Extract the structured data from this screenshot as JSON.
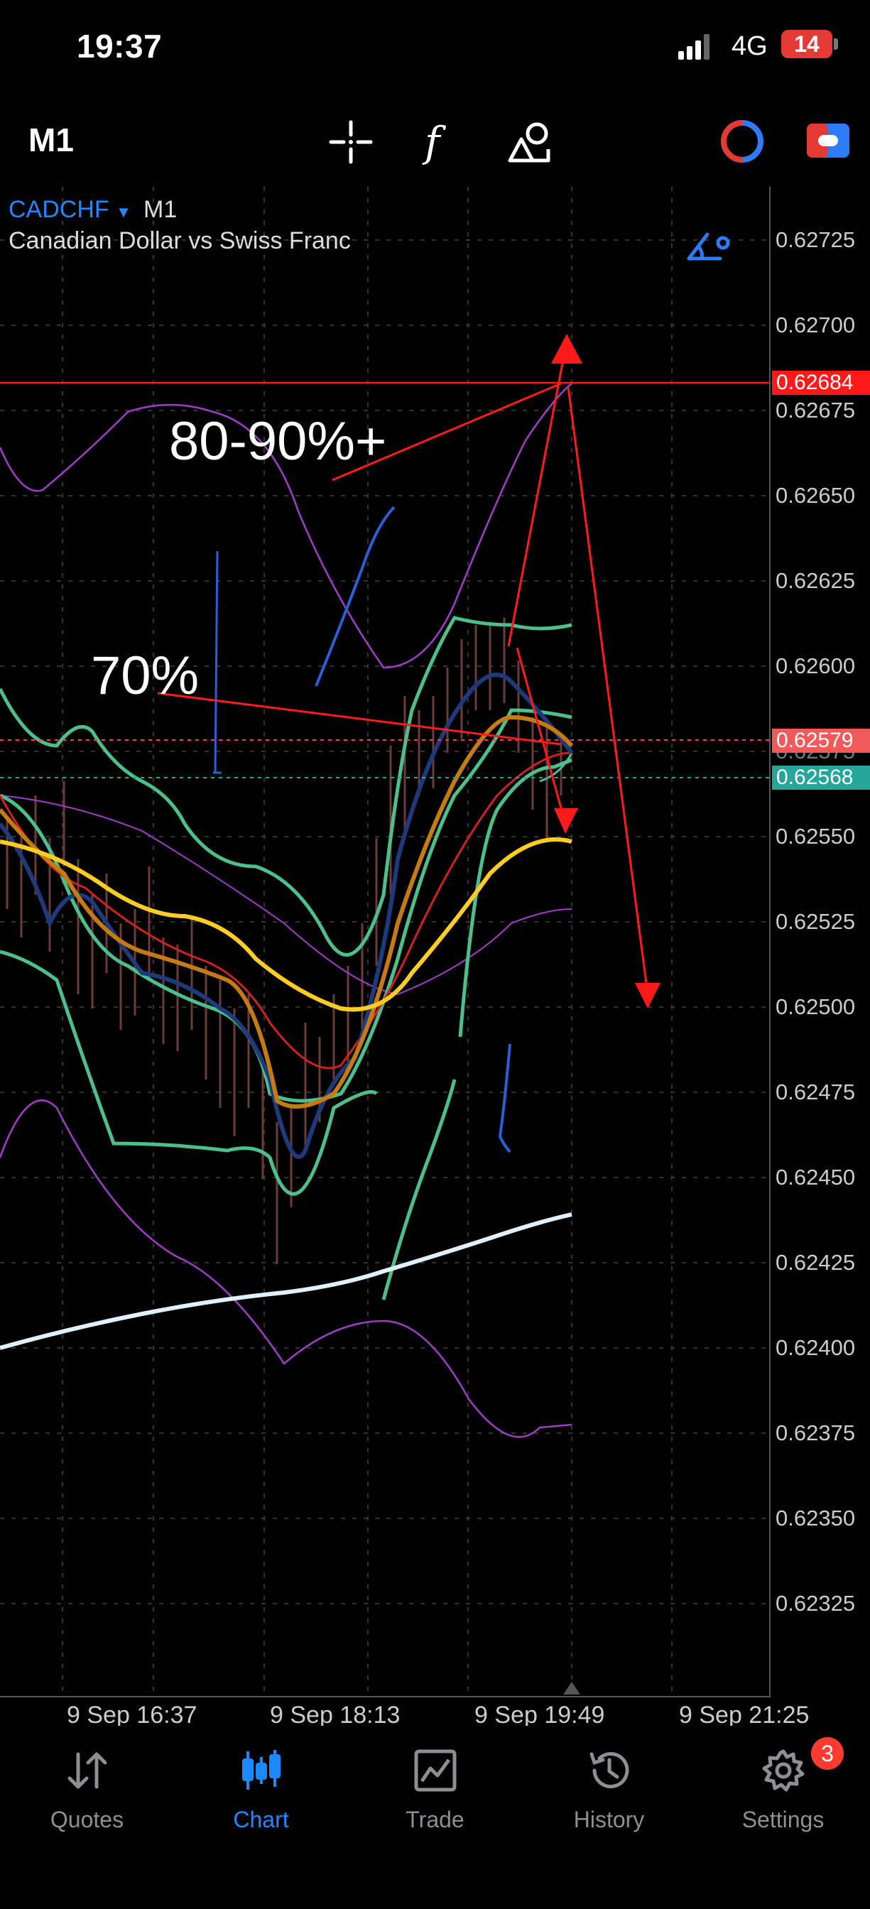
{
  "status_bar": {
    "time": "19:37",
    "network": "4G",
    "battery": "14"
  },
  "toolbar": {
    "timeframe": "M1",
    "tools": [
      "crosshair-icon",
      "indicators-icon",
      "objects-icon"
    ],
    "right_tools": [
      "account-chart-icon",
      "trade-panel-icon"
    ]
  },
  "chart": {
    "symbol": "CADCHF",
    "timeframe": "M1",
    "description": "Canadian Dollar vs Swiss Franc",
    "price_ticks": [
      "0.62725",
      "0.62700",
      "0.62675",
      "0.62650",
      "0.62625",
      "0.62600",
      "0.62575",
      "0.62550",
      "0.62525",
      "0.62500",
      "0.62475",
      "0.62450",
      "0.62425",
      "0.62400",
      "0.62375",
      "0.62350",
      "0.62325"
    ],
    "time_ticks": [
      "9 Sep 16:37",
      "9 Sep 18:13",
      "9 Sep 19:49",
      "9 Sep 21:25"
    ],
    "price_labels": {
      "level_line": {
        "value": "0.62684",
        "color": "#ff1a1a"
      },
      "ask_line": {
        "value": "0.62579",
        "color": "#f05a5a"
      },
      "bid_line": {
        "value": "0.62568",
        "color": "#26a69a"
      }
    },
    "annotations": {
      "upper": "80-90%+",
      "lower": "70%"
    }
  },
  "nav": {
    "items": [
      {
        "label": "Quotes",
        "icon": "quotes-icon"
      },
      {
        "label": "Chart",
        "icon": "chart-icon",
        "active": true
      },
      {
        "label": "Trade",
        "icon": "trade-icon"
      },
      {
        "label": "History",
        "icon": "history-icon"
      },
      {
        "label": "Settings",
        "icon": "settings-icon"
      }
    ],
    "settings_badge": "3"
  }
}
